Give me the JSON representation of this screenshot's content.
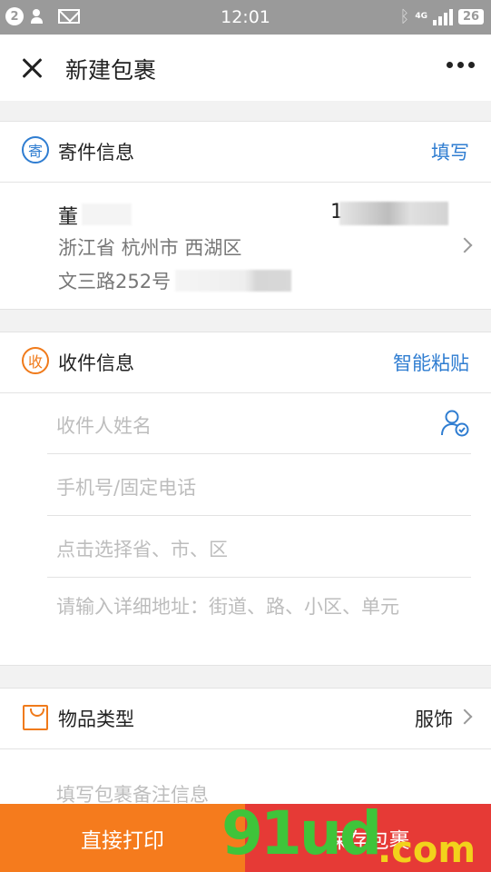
{
  "status_bar": {
    "notification_count": "2",
    "time": "12:01",
    "network": "4G",
    "battery": "26",
    "colors": {
      "background": "#9a9a9a"
    }
  },
  "header": {
    "title": "新建包裹",
    "close_icon": "close-icon",
    "more_icon": "more-icon"
  },
  "sender": {
    "section_icon_text": "寄",
    "section_label": "寄件信息",
    "action": "填写",
    "name": "董",
    "phone": "1",
    "address_line1": "浙江省 杭州市 西湖区",
    "address_line2": "文三路252号"
  },
  "receiver": {
    "section_icon_text": "收",
    "section_label": "收件信息",
    "action": "智能粘贴",
    "name_placeholder": "收件人姓名",
    "phone_placeholder": "手机号/固定电话",
    "region_placeholder": "点击选择省、市、区",
    "address_placeholder": "请输入详细地址：街道、路、小区、单元"
  },
  "item": {
    "label": "物品类型",
    "value": "服饰",
    "note_placeholder": "填写包裹备注信息"
  },
  "bottom_bar": {
    "print_label": "直接打印",
    "save_label": "保存包裹",
    "colors": {
      "print": "#f57b1d",
      "save": "#e63a36"
    }
  },
  "watermark": {
    "brand": "91ud",
    "suffix": ".com"
  },
  "colors": {
    "accent_blue": "#2f7dd1",
    "accent_orange": "#f07a1a"
  }
}
